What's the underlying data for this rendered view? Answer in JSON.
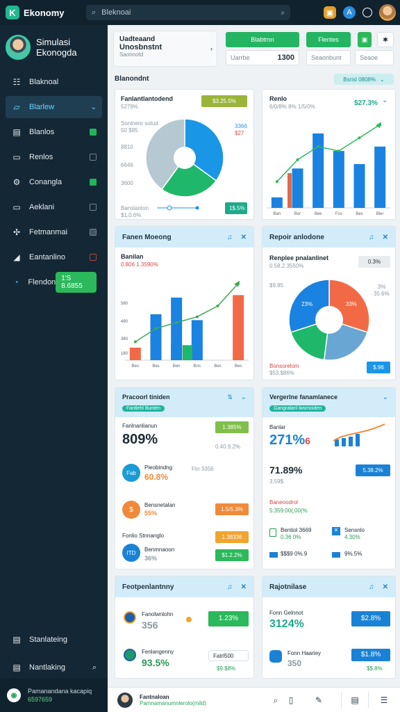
{
  "app": {
    "name": "Ekonomy",
    "logo_glyph": "K"
  },
  "search": {
    "placeholder": "Bleknoai"
  },
  "topbar_icons": [
    "badge-icon",
    "a-icon",
    "chat-icon"
  ],
  "sidebar": {
    "user": {
      "line1": "Simulasi",
      "line2": "Ekonogda"
    },
    "items": [
      {
        "label": "Blaknoal",
        "icon": "grid-icon"
      },
      {
        "label": "Blarlew",
        "icon": "card-icon"
      },
      {
        "label": "Blanlos",
        "icon": "briefcase-icon"
      },
      {
        "label": "Renlos",
        "icon": "folder-icon"
      },
      {
        "label": "Conangla",
        "icon": "gear-icon"
      },
      {
        "label": "Aeklani",
        "icon": "window-icon"
      },
      {
        "label": "Fetmanmai",
        "icon": "puzzle-icon"
      },
      {
        "label": "Eantanlino",
        "icon": "megaphone-icon"
      },
      {
        "label": "Flendon",
        "icon": "clock-icon",
        "badge": "1'S 8.6855"
      }
    ],
    "bottom": [
      {
        "label": "Stanlateing",
        "icon": "briefcase-icon"
      },
      {
        "label": "Nantlaking",
        "icon": "printer-icon"
      }
    ],
    "footer": {
      "line1": "Pamanandana kacapiq",
      "line2": "6597659"
    }
  },
  "header": {
    "line1": "Uadteaand",
    "line2": "Unosbnstnt",
    "line3": "Saonnotd"
  },
  "header_right": {
    "btn1": "Blabtrnn",
    "btn2": "Flentes",
    "field_label": "Uarrbe",
    "field_value": "1300",
    "box1": "Seaonbunt",
    "box2": "Seaoe"
  },
  "section": {
    "title": "Blanondnt",
    "pill": "Bsrisl 0808%"
  },
  "cards": {
    "pie1": {
      "title": "Fanlantlantodend",
      "subtitle": "5279%",
      "chip": "$3.25.5%",
      "top_left": "Sonlnenr sotud",
      "top_left2": "50 $95",
      "right_labels": [
        "3366",
        "$27"
      ],
      "left_labels": [
        "8810",
        "6646",
        "3600"
      ],
      "foot1": "Banslanton",
      "foot2": "$1,0.6%",
      "chip_bottom": "1$.5%",
      "slices": [
        {
          "value": 35,
          "color": "#1a96e6"
        },
        {
          "value": 25,
          "color": "#1fb86b"
        },
        {
          "value": 40,
          "color": "#b6c8d2"
        }
      ]
    },
    "bars1": {
      "title": "Renlo",
      "sub": "6/0/8% 8% 1/5/0%",
      "value": "$27.3%",
      "xlabels": [
        "Ban",
        "Bor",
        "Bee",
        "Fus",
        "Bes",
        "Bler"
      ],
      "values": [
        0.12,
        0.45,
        0.85,
        0.65,
        0.5,
        0.7
      ],
      "line": [
        0.3,
        0.55,
        0.7,
        0.65,
        0.8,
        0.95
      ]
    },
    "bars2": {
      "head": "Fanen Moeong",
      "title": "Banilan",
      "sub": "0.806 1.3590%",
      "ylabels": [
        "580",
        "490",
        "380",
        "180"
      ],
      "xlabels": [
        "Bes",
        "Bes",
        "Ben",
        "Bns",
        "Bes",
        "Bes"
      ],
      "blue": [
        0,
        0.55,
        0.75,
        0.48,
        0,
        0
      ],
      "orange": [
        0.15,
        0,
        0.2,
        0,
        0,
        0.78
      ],
      "green": [
        0,
        0,
        0,
        0.18,
        0,
        0
      ],
      "line": [
        0.22,
        0.38,
        0.45,
        0.52,
        0.65,
        0.92
      ]
    },
    "pie2": {
      "head": "Repoir anlodone",
      "title": "Renplee pnalanlinet",
      "sub": "0.58.2.3550%",
      "chip": "0.3%",
      "left_label": "$9.85",
      "right_labels": [
        "3%",
        "35.6%"
      ],
      "foot1": "Bonsorelom",
      "foot2": "$53.$86%",
      "chip_bottom": "$.96",
      "slice_labels": [
        "23%",
        "33%",
        "33%"
      ],
      "slices": [
        {
          "value": 30,
          "color": "#f26a45"
        },
        {
          "value": 22,
          "color": "#6aa6d4"
        },
        {
          "value": 18,
          "color": "#1fb86b"
        },
        {
          "value": 30,
          "color": "#1a82e0"
        }
      ]
    },
    "stats1": {
      "head": "Pracoorl tiniden",
      "pill": "Fantlehl Bunten",
      "rows": [
        {
          "label": "Fanlnanlianun",
          "value": "809%",
          "chip": "1.385%",
          "chip2": "0.40.9.2%",
          "chip_color": "#7fbf4a"
        },
        {
          "icon_text": "Fab",
          "label": "Pieobindng",
          "value": "60.8%",
          "note": "Ftn 3356",
          "icon_color": "#1a9ad6"
        },
        {
          "icon_text": "$",
          "label": "Bensnetalan",
          "value": "55%",
          "chip": "1.5/5.3%",
          "icon_color": "#f08a3a",
          "chip_color": "#f08a3a"
        },
        {
          "label": "Fonlio Stnnanglo",
          "chip": "1.38336",
          "chip_color": "#f0a530"
        },
        {
          "icon_text": "ITD",
          "label": "Benmnaoon",
          "value": "36%",
          "chip": "$1.2.2%",
          "icon_color": "#1a82d6",
          "chip_color": "#2bb95b"
        }
      ]
    },
    "stats2": {
      "head": "Vergerlne fanamlanece",
      "pill": "Gangralanl lwsmoiden",
      "rows": [
        {
          "label": "Banlar",
          "value": "271%",
          "suffix": "6"
        },
        {
          "label": "",
          "value": "71.89%",
          "sub": "3.59$",
          "chip": "5.38.2%"
        },
        {
          "label": "Baneoodrol",
          "sub": "5:359:00(,00(%"
        },
        {
          "label": "Bentiol 3669",
          "sub": "0.36 0%",
          "label2": "Sensnlo",
          "sub2": "4.30%"
        },
        {
          "label": "$$$9 0%.9",
          "label2": "9%.5%"
        }
      ]
    },
    "mini1": {
      "head": "Feotpenlantnny",
      "row1": {
        "label": "Fanolwnlohn",
        "value": "356",
        "chip": "1.23%"
      },
      "row2": {
        "label": "Fenlangenny",
        "value": "93.5%",
        "chip": "Fatrl500",
        "note": "$9.$8%"
      }
    },
    "mini2": {
      "head": "Rajotnilase",
      "row1": {
        "label": "Fonn Gelnnot",
        "value": "3124%",
        "chip": "$2.8%"
      },
      "row2": {
        "label": "Fonn Haariey",
        "value": "350",
        "chip": "$1.8%",
        "note": "$$.8%"
      }
    }
  },
  "bottombar": {
    "name": "Fantnaloan",
    "sub": "Pamnamanumnlerolo(mild)"
  }
}
